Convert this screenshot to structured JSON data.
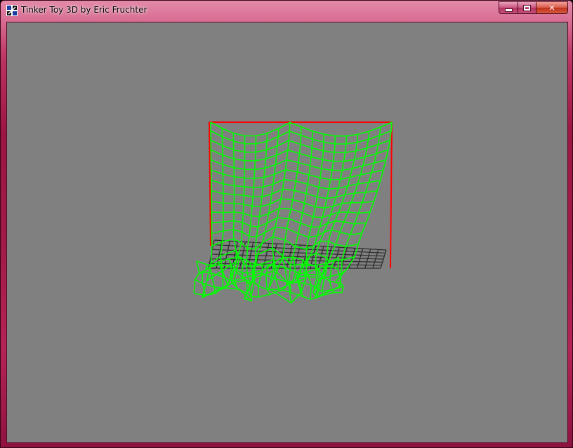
{
  "window": {
    "title": "Tinker Toy 3D by Eric Fruchter",
    "icon": "app-icon",
    "buttons": {
      "minimize": "minimize-icon",
      "maximize": "maximize-icon",
      "close": "close-icon",
      "close_glyph": "✕"
    }
  },
  "viewport": {
    "background_color": "#808080",
    "scene": {
      "frame_color": "#ff0000",
      "cloth_color": "#00ff00",
      "shadow_color": "#2a2a2a",
      "cloth_grid": {
        "columns": 16,
        "rows": 15
      }
    }
  }
}
